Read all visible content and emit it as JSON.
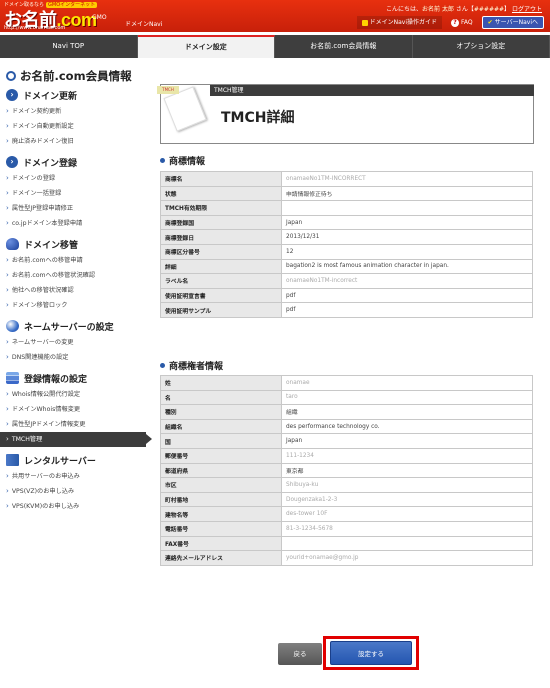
{
  "header": {
    "tagline": "ドメイン取るなら",
    "tagline_pill": "GMOインターネット",
    "logo_text": "お名前",
    "logo_dom": ".com",
    "logo_url": "http://www.onamae.com",
    "logo_sub": "GMO",
    "logo_navi": "ドメインNavi",
    "greeting_prefix": "こんにちは、",
    "user_name": "お名前 太郎",
    "greeting_suffix": " さん【",
    "user_id": "######",
    "greeting_end": "】",
    "logout": "ログアウト",
    "guide_button": "ドメインNavi操作ガイド",
    "faq_button": "FAQ",
    "server_navi_button": "サーバーNaviへ"
  },
  "nav": {
    "tabs": [
      {
        "label": "Navi TOP",
        "active": false
      },
      {
        "label": "ドメイン設定",
        "active": true
      },
      {
        "label": "お名前.com会員情報",
        "active": false
      },
      {
        "label": "オプション設定",
        "active": false
      }
    ]
  },
  "sidebar": {
    "title": "お名前.com会員情報",
    "sections": [
      {
        "title": "ドメイン更新",
        "icon": "arrow-circle-icon",
        "items": [
          "ドメイン契約更新",
          "ドメイン自動更新設定",
          "廃止済みドメイン復旧"
        ]
      },
      {
        "title": "ドメイン登録",
        "icon": "arrow-circle-icon",
        "items": [
          "ドメインの登録",
          "ドメイン一括登録",
          "属性型JP登録申請修正",
          "co.jpドメイン本登録申請"
        ]
      },
      {
        "title": "ドメイン移管",
        "icon": "people-icon",
        "items": [
          "お名前.comへの移管申請",
          "お名前.comへの移管状況確認",
          "他社への移管状況確認",
          "ドメイン移管ロック"
        ]
      },
      {
        "title": "ネームサーバーの設定",
        "icon": "globe-icon",
        "items": [
          "ネームサーバーの変更",
          "DNS関連機能の設定"
        ]
      },
      {
        "title": "登録情報の設定",
        "icon": "stack-icon",
        "items": [
          "Whois情報公開代行設定",
          "ドメインWhois情報変更",
          "属性型JPドメイン情報変更",
          "TMCH管理"
        ]
      },
      {
        "title": "レンタルサーバー",
        "icon": "server-icon",
        "items": [
          "共用サーバーのお申込み",
          "VPS(VZ)のお申し込み",
          "VPS(KVM)のお申し込み"
        ]
      }
    ],
    "active_item": "TMCH管理"
  },
  "banner": {
    "head": "TMCH管理",
    "title": "TMCH詳細",
    "note_label": "TMCH"
  },
  "trademark": {
    "heading": "商標情報",
    "rows": [
      {
        "k": "商標名",
        "v": "onamaeNo1TM-INCORRECT",
        "blur": true
      },
      {
        "k": "状態",
        "v": "申請情報修正待ち",
        "blur": false
      },
      {
        "k": "TMCH有効期限",
        "v": "",
        "blur": false
      },
      {
        "k": "商標登録国",
        "v": "Japan",
        "blur": false
      },
      {
        "k": "商標登録日",
        "v": "2013/12/31",
        "blur": false
      },
      {
        "k": "商標区分番号",
        "v": "12",
        "blur": false
      },
      {
        "k": "詳細",
        "v": "bagation2 is most famous animation character in japan.",
        "blur": false
      },
      {
        "k": "ラベル名",
        "v": "onamaeNo1TM-incorrect",
        "blur": true
      },
      {
        "k": "使用証明宣言書",
        "v": "pdf",
        "blur": false
      },
      {
        "k": "使用証明サンプル",
        "v": "pdf",
        "blur": false
      }
    ]
  },
  "holder": {
    "heading": "商標権者情報",
    "rows": [
      {
        "k": "姓",
        "v": "onamae",
        "blur": true
      },
      {
        "k": "名",
        "v": "taro",
        "blur": true
      },
      {
        "k": "種別",
        "v": "組織",
        "blur": false
      },
      {
        "k": "組織名",
        "v": "des performance technology co.",
        "blur": false
      },
      {
        "k": "国",
        "v": "Japan",
        "blur": false
      },
      {
        "k": "郵便番号",
        "v": "111-1234",
        "blur": true
      },
      {
        "k": "都道府県",
        "v": "東京都",
        "blur": false
      },
      {
        "k": "市区",
        "v": "Shibuya-ku",
        "blur": true
      },
      {
        "k": "町村番地",
        "v": "Dougenzaka1-2-3",
        "blur": true
      },
      {
        "k": "建物名等",
        "v": "des-tower 10F",
        "blur": true
      },
      {
        "k": "電話番号",
        "v": "81-3-1234-5678",
        "blur": true
      },
      {
        "k": "FAX番号",
        "v": "",
        "blur": false
      },
      {
        "k": "連絡先メールアドレス",
        "v": "yourid+onamae@gmo.jp",
        "blur": true
      }
    ]
  },
  "buttons": {
    "back": "戻る",
    "submit": "設定する"
  }
}
